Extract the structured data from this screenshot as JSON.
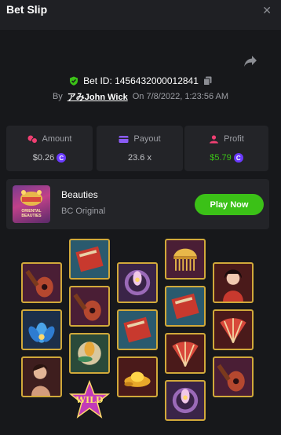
{
  "header": {
    "title": "Bet Slip",
    "close_icon": "close-icon"
  },
  "bet": {
    "id_label": "Bet ID: 1456432000012841",
    "by": "By",
    "user": "アみJohn Wick",
    "on": "On 7/8/2022, 1:23:56 AM"
  },
  "stats": {
    "amount": {
      "label": "Amount",
      "value": "$0.26"
    },
    "payout": {
      "label": "Payout",
      "value": "23.6 x"
    },
    "profit": {
      "label": "Profit",
      "value": "$5.79"
    }
  },
  "game": {
    "name": "Beauties",
    "provider": "BC Original",
    "play_label": "Play Now",
    "thumb_text": "ORIENTAL BEAUTIES"
  },
  "reels": {
    "columns": [
      [
        "pipa",
        "lotus",
        "lady"
      ],
      [
        "book",
        "pipa",
        "lotus-gold",
        "wild"
      ],
      [
        "lotus-ring",
        "book",
        "gold"
      ],
      [
        "comb",
        "book",
        "fan",
        "lotus-ring"
      ],
      [
        "lady",
        "fan",
        "pipa"
      ]
    ],
    "wild_label": "WILD"
  },
  "colors": {
    "accent_green": "#3bc117",
    "coin_purple": "#6a3aff",
    "gold_frame": "#d1a93a"
  }
}
